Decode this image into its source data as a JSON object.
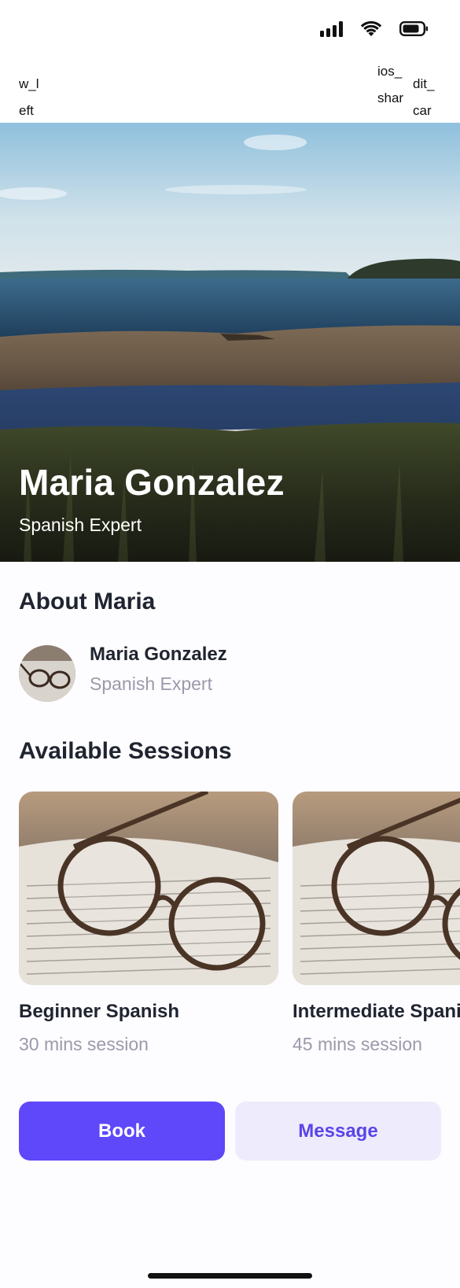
{
  "nav": {
    "left_label": "w_left_",
    "right_label_1": "ios_share",
    "right_label_2": "dit_car"
  },
  "hero": {
    "name": "Maria Gonzalez",
    "role": "Spanish Expert"
  },
  "about": {
    "title": "About Maria",
    "name": "Maria Gonzalez",
    "role": "Spanish Expert"
  },
  "sessions": {
    "title": "Available Sessions",
    "items": [
      {
        "name": "Beginner Spanish",
        "duration": "30 mins session"
      },
      {
        "name": "Intermediate Spanish",
        "duration": "45 mins session"
      }
    ]
  },
  "actions": {
    "book_label": "Book",
    "message_label": "Message"
  },
  "colors": {
    "accent": "#5f48f9",
    "accent_soft": "#eeebfc",
    "text_primary": "#1f2430",
    "text_secondary": "#9b9aab"
  },
  "icons": [
    "signal-icon",
    "wifi-icon",
    "battery-icon"
  ]
}
